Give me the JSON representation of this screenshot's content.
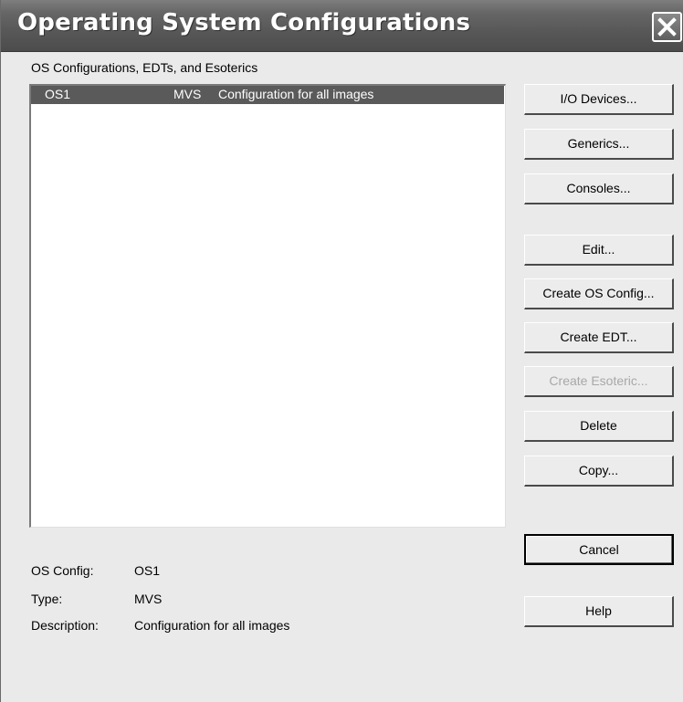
{
  "window": {
    "title": "Operating System Configurations",
    "close_icon": "close-x-icon"
  },
  "list": {
    "label": "OS Configurations, EDTs, and Esoterics",
    "rows": [
      {
        "name": "OS1",
        "type": "MVS",
        "description": "Configuration for all images",
        "selected": true
      }
    ]
  },
  "buttons": {
    "io_devices": "I/O Devices...",
    "generics": "Generics...",
    "consoles": "Consoles...",
    "edit": "Edit...",
    "create_os_config": "Create OS Config...",
    "create_edt": "Create EDT...",
    "create_esoteric": "Create Esoteric...",
    "delete": "Delete",
    "copy": "Copy...",
    "cancel": "Cancel",
    "help": "Help"
  },
  "details": {
    "os_config_label": "OS Config:",
    "os_config_value": "OS1",
    "type_label": "Type:",
    "type_value": "MVS",
    "description_label": "Description:",
    "description_value": "Configuration for all images"
  },
  "colors": {
    "selection": "#5a5a5a",
    "disabled_text": "#a8a8a8"
  }
}
